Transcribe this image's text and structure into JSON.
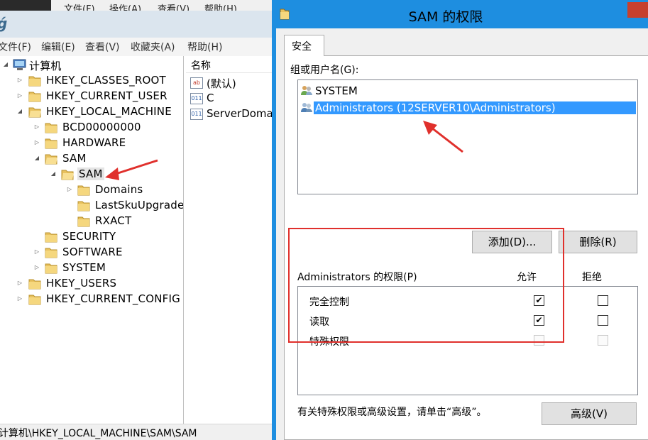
{
  "background_window": {
    "menu": [
      "文件(F)",
      "操作(A)",
      "查看(V)",
      "帮助(H)"
    ]
  },
  "regedit": {
    "menu": [
      "文件(F)",
      "编辑(E)",
      "查看(V)",
      "收藏夹(A)",
      "帮助(H)"
    ],
    "tree": [
      {
        "label": "计算机",
        "expander": "◢"
      },
      {
        "label": "HKEY_CLASSES_ROOT",
        "expander": "▷"
      },
      {
        "label": "HKEY_CURRENT_USER",
        "expander": "▷"
      },
      {
        "label": "HKEY_LOCAL_MACHINE",
        "expander": "◢"
      },
      {
        "label": "BCD00000000",
        "expander": "▷"
      },
      {
        "label": "HARDWARE",
        "expander": "▷"
      },
      {
        "label": "SAM",
        "expander": "◢"
      },
      {
        "label": "SAM",
        "expander": "◢"
      },
      {
        "label": "Domains",
        "expander": "▷"
      },
      {
        "label": "LastSkuUpgrade",
        "expander": ""
      },
      {
        "label": "RXACT",
        "expander": ""
      },
      {
        "label": "SECURITY",
        "expander": ""
      },
      {
        "label": "SOFTWARE",
        "expander": "▷"
      },
      {
        "label": "SYSTEM",
        "expander": "▷"
      },
      {
        "label": "HKEY_USERS",
        "expander": "▷"
      },
      {
        "label": "HKEY_CURRENT_CONFIG",
        "expander": "▷"
      }
    ],
    "list_header": "名称",
    "list_items": [
      {
        "label": "(默认)",
        "icon": "ab",
        "icon_name": "string-value-icon"
      },
      {
        "label": "C",
        "icon": "011",
        "icon_name": "binary-value-icon"
      },
      {
        "label": "ServerDoma",
        "icon": "011",
        "icon_name": "binary-value-icon"
      }
    ],
    "status_path": "计算机\\HKEY_LOCAL_MACHINE\\SAM\\SAM"
  },
  "dialog": {
    "title": "SAM 的权限",
    "tab": "安全",
    "group_label": "组或用户名(G):",
    "users": [
      {
        "label": "SYSTEM",
        "selected": false
      },
      {
        "label": "Administrators (12SERVER10\\Administrators)",
        "selected": true
      }
    ],
    "add_button": "添加(D)...",
    "remove_button": "删除(R)",
    "perm_label": "Administrators 的权限(P)",
    "allow_header": "允许",
    "deny_header": "拒绝",
    "permissions": [
      {
        "label": "完全控制",
        "allow": "✔",
        "deny": ""
      },
      {
        "label": "读取",
        "allow": "✔",
        "deny": ""
      },
      {
        "label": "特殊权限",
        "allow": "",
        "deny": ""
      }
    ],
    "advanced_note": "有关特殊权限或高级设置，请单击“高级”。",
    "advanced_button": "高级(V)"
  },
  "colors": {
    "dialog_frame": "#1e8ee0",
    "selection": "#3399ff",
    "annotation_red": "#e0302c"
  }
}
